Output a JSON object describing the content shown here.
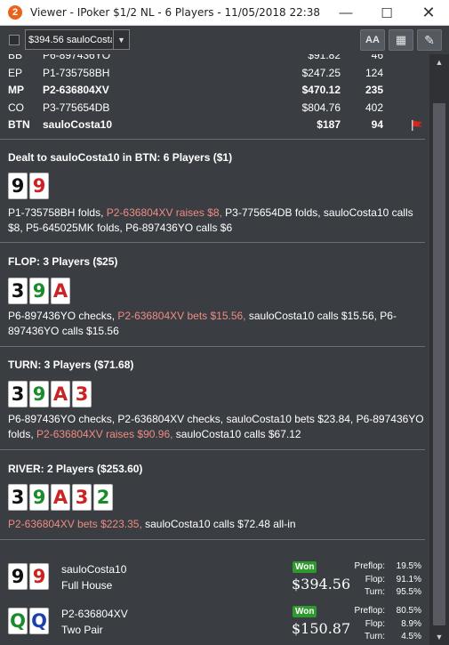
{
  "window": {
    "title": "Viewer - IPoker $1/2 NL - 6 Players - 11/05/2018 22:38",
    "app_icon": "2",
    "minimize": "—",
    "maximize": "☐",
    "close": "✕"
  },
  "toolbar": {
    "player_select": "$394.56 sauloCosta",
    "font_button": "AA",
    "grid_button": "▦",
    "edit_button": "✎"
  },
  "players": [
    {
      "pos": "BB",
      "name": "P6-897436YO",
      "stack": "$91.82",
      "bb": "46",
      "bold": false
    },
    {
      "pos": "EP",
      "name": "P1-735758BH",
      "stack": "$247.25",
      "bb": "124",
      "bold": false
    },
    {
      "pos": "MP",
      "name": "P2-636804XV",
      "stack": "$470.12",
      "bb": "235",
      "bold": true
    },
    {
      "pos": "CO",
      "name": "P3-775654DB",
      "stack": "$804.76",
      "bb": "402",
      "bold": false
    },
    {
      "pos": "BTN",
      "name": "sauloCosta10",
      "stack": "$187",
      "bb": "94",
      "bold": true
    }
  ],
  "preflop": {
    "title": "Dealt to sauloCosta10 in BTN: 6 Players ($1)",
    "cards": [
      {
        "rank": "9",
        "suit": "clubs",
        "color": "#111111"
      },
      {
        "rank": "9",
        "suit": "hearts",
        "color": "#cc2222"
      }
    ],
    "action_a": "P1-735758BH folds, ",
    "action_hl": "P2-636804XV raises $8, ",
    "action_b": "P3-775654DB folds, sauloCosta10 calls $8, P5-645025MK folds, P6-897436YO calls $6"
  },
  "flop": {
    "title": "FLOP: 3 Players ($25)",
    "cards": [
      {
        "rank": "3",
        "color": "#111111"
      },
      {
        "rank": "9",
        "color": "#1a8a2a"
      },
      {
        "rank": "A",
        "color": "#cc2222"
      }
    ],
    "action_a": "P6-897436YO checks, ",
    "action_hl": "P2-636804XV bets $15.56, ",
    "action_b": "sauloCosta10 calls $15.56, P6-897436YO calls $15.56"
  },
  "turn": {
    "title": "TURN: 3 Players ($71.68)",
    "cards": [
      {
        "rank": "3",
        "color": "#111111"
      },
      {
        "rank": "9",
        "color": "#1a8a2a"
      },
      {
        "rank": "A",
        "color": "#cc2222"
      },
      {
        "rank": "3",
        "color": "#cc2222"
      }
    ],
    "action_a": "P6-897436YO checks, P2-636804XV checks, sauloCosta10 bets $23.84, P6-897436YO folds, ",
    "action_hl": "P2-636804XV raises $90.96, ",
    "action_b": "sauloCosta10 calls $67.12"
  },
  "river": {
    "title": "RIVER: 2 Players ($253.60)",
    "cards": [
      {
        "rank": "3",
        "color": "#111111"
      },
      {
        "rank": "9",
        "color": "#1a8a2a"
      },
      {
        "rank": "A",
        "color": "#cc2222"
      },
      {
        "rank": "3",
        "color": "#cc2222"
      },
      {
        "rank": "2",
        "color": "#1a8a2a"
      }
    ],
    "action_hl": "P2-636804XV bets $223.35, ",
    "action_b": "sauloCosta10 calls $72.48 all-in"
  },
  "results": [
    {
      "name": "sauloCosta10",
      "hand": "Full House",
      "won_label": "Won",
      "amount": "$394.56",
      "cards": [
        {
          "rank": "9",
          "color": "#111111"
        },
        {
          "rank": "9",
          "color": "#cc2222"
        }
      ],
      "stats": [
        {
          "label": "Preflop:",
          "value": "19.5%"
        },
        {
          "label": "Flop:",
          "value": "91.1%"
        },
        {
          "label": "Turn:",
          "value": "95.5%"
        }
      ]
    },
    {
      "name": "P2-636804XV",
      "hand": "Two Pair",
      "won_label": "Won",
      "amount": "$150.87",
      "cards": [
        {
          "rank": "Q",
          "color": "#1a8a2a"
        },
        {
          "rank": "Q",
          "color": "#1e3fae"
        }
      ],
      "stats": [
        {
          "label": "Preflop:",
          "value": "80.5%"
        },
        {
          "label": "Flop:",
          "value": "8.9%"
        },
        {
          "label": "Turn:",
          "value": "4.5%"
        }
      ]
    }
  ],
  "scrollbar": {
    "up": "▲",
    "down": "▼"
  }
}
